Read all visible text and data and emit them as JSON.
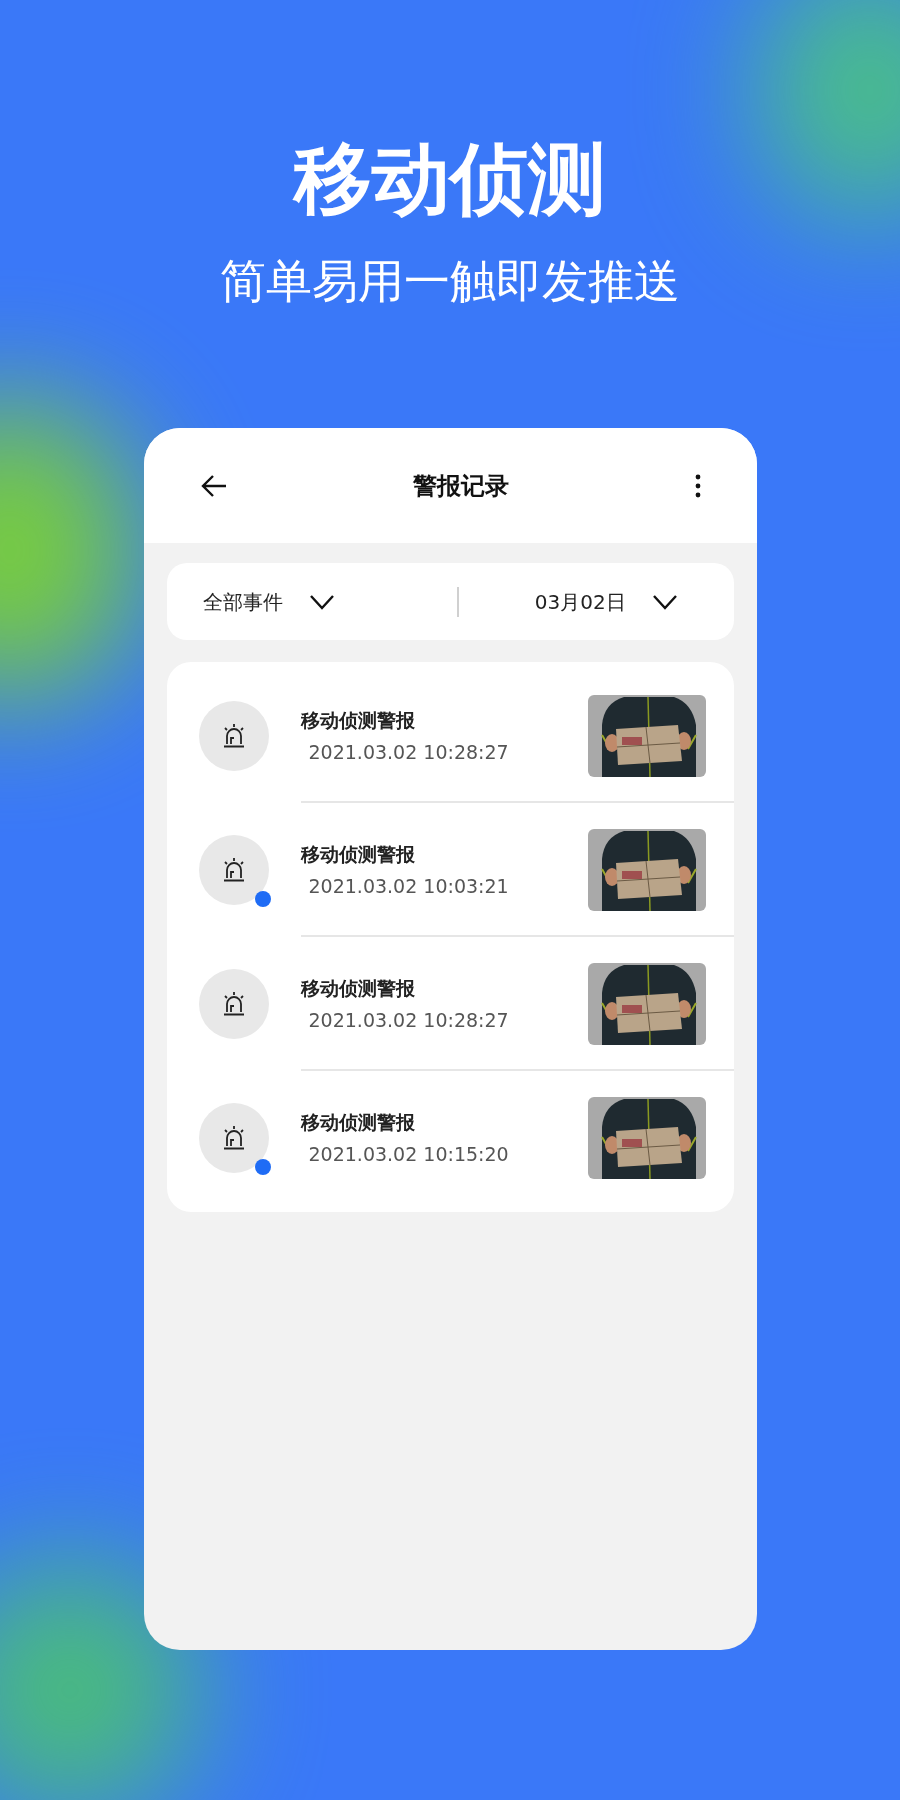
{
  "headline": "移动侦测",
  "subheadline": "简单易用一触即发推送",
  "screen": {
    "title": "警报记录",
    "filters": [
      {
        "label": "全部事件"
      },
      {
        "label": "03月02日"
      }
    ],
    "alerts": [
      {
        "title": "移动侦测警报",
        "time": "2021.03.02 10:28:27",
        "unread": false
      },
      {
        "title": "移动侦测警报",
        "time": "2021.03.02 10:03:21",
        "unread": true
      },
      {
        "title": "移动侦测警报",
        "time": "2021.03.02 10:28:27",
        "unread": false
      },
      {
        "title": "移动侦测警报",
        "time": "2021.03.02 10:15:20",
        "unread": true
      }
    ]
  }
}
